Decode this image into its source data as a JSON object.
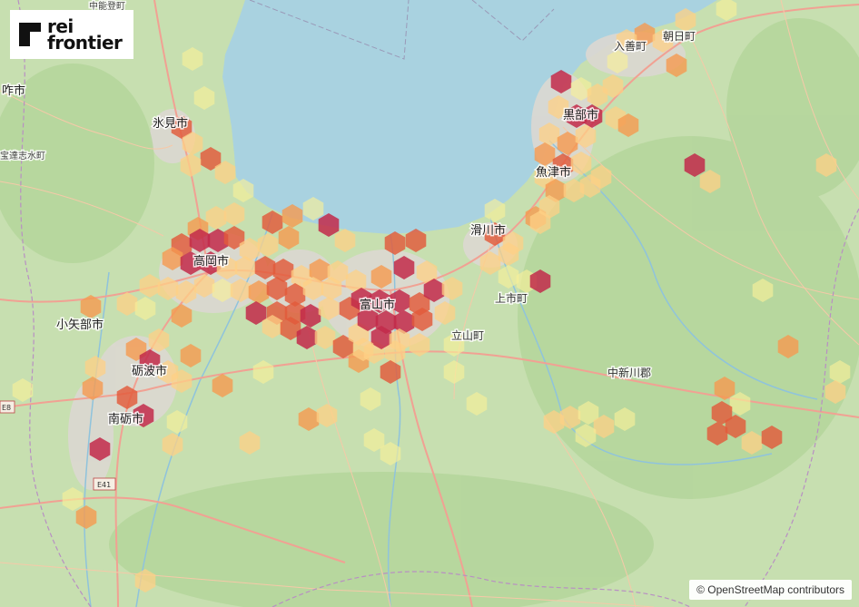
{
  "logo": {
    "line1": "rei",
    "line2": "frontier",
    "bg": "#ffffff",
    "color": "#111111"
  },
  "attribution": {
    "text": "© OpenStreetMap contributors"
  },
  "map": {
    "water_color": "#a9d2e0",
    "land_color": "#c7dfb0",
    "places": [
      {
        "name": "富山市",
        "cls": "big"
      },
      {
        "name": "高岡市",
        "cls": "big"
      },
      {
        "name": "氷見市",
        "cls": "big"
      },
      {
        "name": "砺波市",
        "cls": "big"
      },
      {
        "name": "南砺市",
        "cls": "big"
      },
      {
        "name": "小矢部市",
        "cls": "big"
      },
      {
        "name": "滑川市",
        "cls": "big"
      },
      {
        "name": "魚津市",
        "cls": "big"
      },
      {
        "name": "黒部市",
        "cls": "big"
      },
      {
        "name": "入善町",
        "cls": ""
      },
      {
        "name": "朝日町",
        "cls": ""
      },
      {
        "name": "上市町",
        "cls": ""
      },
      {
        "name": "立山町",
        "cls": ""
      },
      {
        "name": "中新川郡",
        "cls": ""
      },
      {
        "name": "咋市",
        "cls": "big"
      },
      {
        "name": "宝達志水町",
        "cls": "small"
      },
      {
        "name": "中能登町",
        "cls": "small"
      }
    ],
    "shields": [
      "E41",
      "E8"
    ],
    "hex_colors": {
      "l1": "#f7ef9a",
      "l2": "#fdd085",
      "l3": "#f59a50",
      "l4": "#e25a3a",
      "l5": "#c22a4a"
    }
  }
}
